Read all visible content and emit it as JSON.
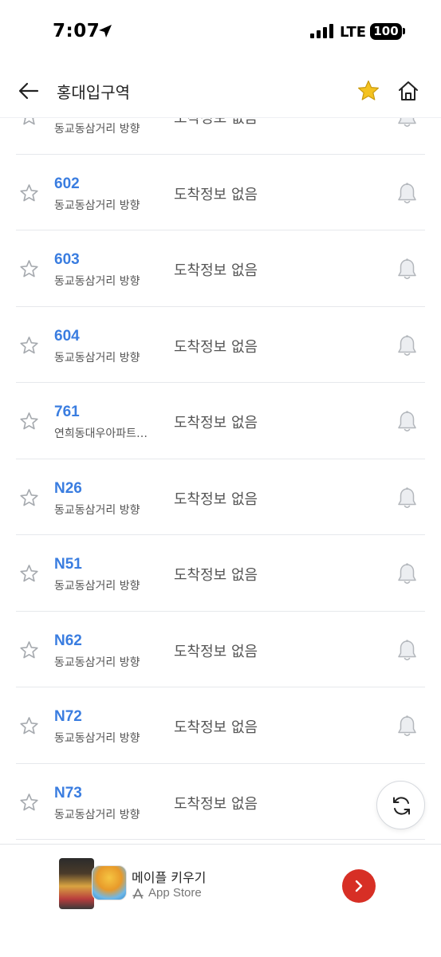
{
  "status_bar": {
    "time": "7:07",
    "network": "LTE",
    "battery": "100"
  },
  "header": {
    "title": "홍대입구역"
  },
  "bus_list": [
    {
      "number": "",
      "direction": "동교동삼거리 방향",
      "arrival": "도착정보 없음"
    },
    {
      "number": "602",
      "direction": "동교동삼거리 방향",
      "arrival": "도착정보 없음"
    },
    {
      "number": "603",
      "direction": "동교동삼거리 방향",
      "arrival": "도착정보 없음"
    },
    {
      "number": "604",
      "direction": "동교동삼거리 방향",
      "arrival": "도착정보 없음"
    },
    {
      "number": "761",
      "direction": "연희동대우아파트…",
      "arrival": "도착정보 없음"
    },
    {
      "number": "N26",
      "direction": "동교동삼거리 방향",
      "arrival": "도착정보 없음"
    },
    {
      "number": "N51",
      "direction": "동교동삼거리 방향",
      "arrival": "도착정보 없음"
    },
    {
      "number": "N62",
      "direction": "동교동삼거리 방향",
      "arrival": "도착정보 없음"
    },
    {
      "number": "N72",
      "direction": "동교동삼거리 방향",
      "arrival": "도착정보 없음"
    },
    {
      "number": "N73",
      "direction": "동교동삼거리 방향",
      "arrival": "도착정보 없음"
    }
  ],
  "ad": {
    "title": "메이플 키우기",
    "store": "App Store"
  },
  "colors": {
    "bus_number": "#3a7de0",
    "favorite_active": "#f4c21f",
    "ad_button": "#d72f25"
  }
}
